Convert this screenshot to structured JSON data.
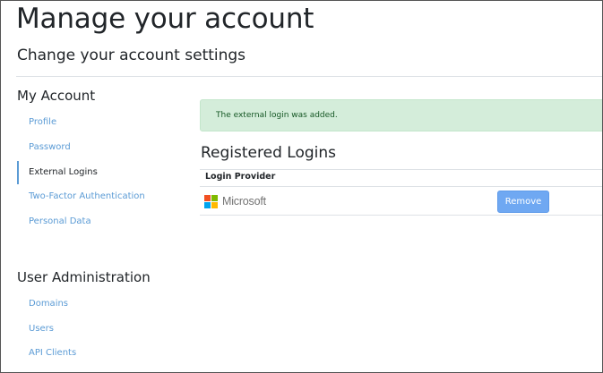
{
  "header": {
    "title": "Manage your account",
    "subtitle": "Change your account settings"
  },
  "sidebar": {
    "my_account": {
      "heading": "My Account",
      "items": [
        {
          "label": "Profile",
          "active": false
        },
        {
          "label": "Password",
          "active": false
        },
        {
          "label": "External Logins",
          "active": true
        },
        {
          "label": "Two-Factor Authentication",
          "active": false
        },
        {
          "label": "Personal Data",
          "active": false
        }
      ]
    },
    "user_admin": {
      "heading": "User Administration",
      "items": [
        {
          "label": "Domains"
        },
        {
          "label": "Users"
        },
        {
          "label": "API Clients"
        }
      ]
    }
  },
  "main": {
    "alert_message": "The external login was added.",
    "registered_heading": "Registered Logins",
    "table": {
      "header": "Login Provider",
      "rows": [
        {
          "provider": "Microsoft",
          "action_label": "Remove"
        }
      ]
    }
  },
  "colors": {
    "link": "#5b9bd5",
    "alert_bg": "#d4edda",
    "alert_text": "#155724",
    "button": "#6fa8f2",
    "ms_red": "#f25022",
    "ms_green": "#7fba00",
    "ms_blue": "#00a4ef",
    "ms_yellow": "#ffb900"
  },
  "icons": {
    "provider_logo": "microsoft-logo-icon"
  }
}
